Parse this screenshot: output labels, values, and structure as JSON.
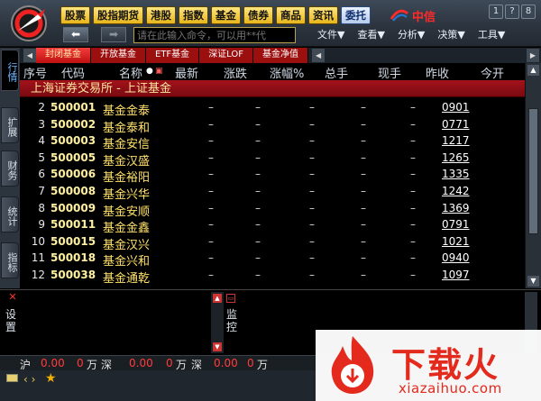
{
  "toolbar": {
    "quick_buttons": [
      "股票",
      "股指期货",
      "港股",
      "指数",
      "基金",
      "债券",
      "商品",
      "资讯",
      "委托"
    ],
    "brand": "中信",
    "command_placeholder": "请在此输入命令，可以用**代",
    "menus": [
      "文件▼",
      "查看▼",
      "分析▼",
      "决策▼",
      "工具▼"
    ],
    "window_buttons": [
      "1",
      "?",
      "8"
    ]
  },
  "side_tabs": [
    "行情",
    "扩展",
    "财务",
    "统计",
    "指标"
  ],
  "category_tabs": [
    "封闭基金",
    "开放基金",
    "ETF基金",
    "深证LOF",
    "基金净值"
  ],
  "table": {
    "headers": [
      "序号",
      "代码",
      "名称",
      "最新",
      "涨跌",
      "涨幅%",
      "总手",
      "现手",
      "昨收",
      "今开"
    ],
    "section_title": "上海证券交易所 - 上证基金",
    "rows": [
      {
        "idx": "2",
        "code": "500001",
        "name": "基金金泰",
        "close": "0901"
      },
      {
        "idx": "3",
        "code": "500002",
        "name": "基金泰和",
        "close": "0771"
      },
      {
        "idx": "4",
        "code": "500003",
        "name": "基金安信",
        "close": "1217"
      },
      {
        "idx": "5",
        "code": "500005",
        "name": "基金汉盛",
        "close": "1265"
      },
      {
        "idx": "6",
        "code": "500006",
        "name": "基金裕阳",
        "close": "1335"
      },
      {
        "idx": "7",
        "code": "500008",
        "name": "基金兴华",
        "close": "1242"
      },
      {
        "idx": "8",
        "code": "500009",
        "name": "基金安顺",
        "close": "1369"
      },
      {
        "idx": "9",
        "code": "500011",
        "name": "基金金鑫",
        "close": "0791"
      },
      {
        "idx": "10",
        "code": "500015",
        "name": "基金汉兴",
        "close": "1021"
      },
      {
        "idx": "11",
        "code": "500018",
        "name": "基金兴和",
        "close": "0940"
      },
      {
        "idx": "12",
        "code": "500038",
        "name": "基金通乾",
        "close": "1097"
      }
    ],
    "dash": "–"
  },
  "bottom_panel": {
    "left_label": "设置",
    "right_label": "监控"
  },
  "status": {
    "sh_label": "沪",
    "sh_val1": "0.00",
    "sh_val2": "0",
    "unit": "万",
    "sz_label": "深",
    "sz_val1": "0.00",
    "sz_val2": "0",
    "more_val1": "0.00",
    "more_val2": "0",
    "nav": "‹ ›"
  },
  "watermark": {
    "cn": "下载火",
    "en": "xiazaihuo.com"
  },
  "colors": {
    "section_bar": "#a3121b",
    "active_tab": "#f23c3c",
    "status_value": "#ff3c3c",
    "fund_name": "#ffe16a",
    "watermark": "#e4291d"
  }
}
